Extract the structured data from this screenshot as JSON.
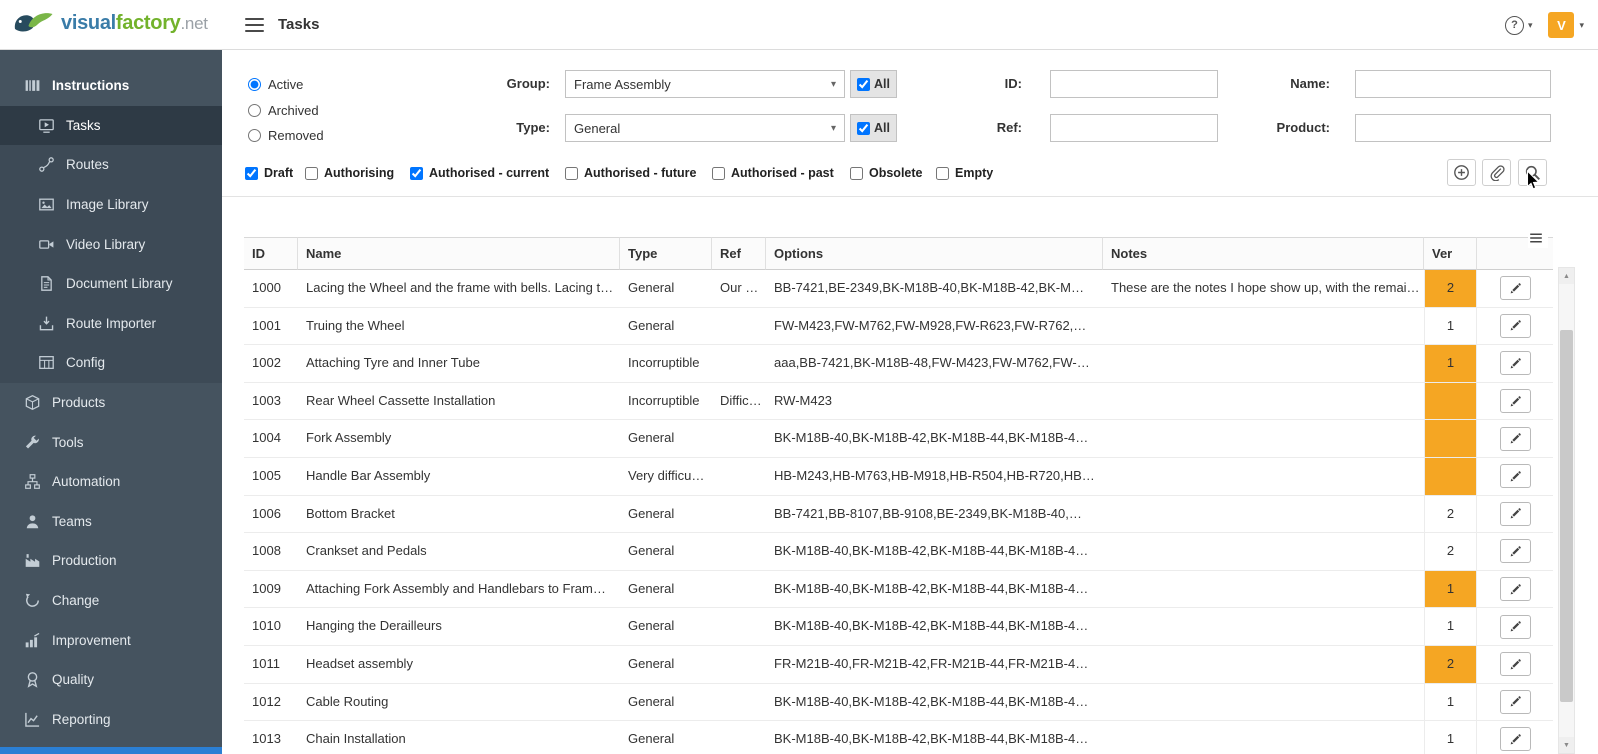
{
  "topbar": {
    "brand": {
      "part1": "visual",
      "part2": "factory",
      "part3": ".net"
    },
    "page_title": "Tasks",
    "help_glyph": "?",
    "chevron_glyph": "▾",
    "avatar_initial": "V"
  },
  "sidebar": {
    "items": [
      {
        "label": "Instructions",
        "icon": "instructions-icon",
        "level": 0,
        "header": true
      },
      {
        "label": "Tasks",
        "icon": "tasks-icon",
        "level": 1,
        "active": true
      },
      {
        "label": "Routes",
        "icon": "routes-icon",
        "level": 1
      },
      {
        "label": "Image Library",
        "icon": "image-library-icon",
        "level": 1
      },
      {
        "label": "Video Library",
        "icon": "video-library-icon",
        "level": 1
      },
      {
        "label": "Document Library",
        "icon": "document-library-icon",
        "level": 1
      },
      {
        "label": "Route Importer",
        "icon": "route-importer-icon",
        "level": 1
      },
      {
        "label": "Config",
        "icon": "config-icon",
        "level": 1
      },
      {
        "label": "Products",
        "icon": "products-icon",
        "level": 0
      },
      {
        "label": "Tools",
        "icon": "tools-icon",
        "level": 0
      },
      {
        "label": "Automation",
        "icon": "automation-icon",
        "level": 0
      },
      {
        "label": "Teams",
        "icon": "teams-icon",
        "level": 0
      },
      {
        "label": "Production",
        "icon": "production-icon",
        "level": 0
      },
      {
        "label": "Change",
        "icon": "change-icon",
        "level": 0
      },
      {
        "label": "Improvement",
        "icon": "improvement-icon",
        "level": 0
      },
      {
        "label": "Quality",
        "icon": "quality-icon",
        "level": 0
      },
      {
        "label": "Reporting",
        "icon": "reporting-icon",
        "level": 0
      }
    ]
  },
  "filters": {
    "status_options": [
      {
        "label": "Active",
        "checked": true
      },
      {
        "label": "Archived",
        "checked": false
      },
      {
        "label": "Removed",
        "checked": false
      }
    ],
    "group": {
      "label": "Group:",
      "value": "Frame Assembly"
    },
    "group_all": {
      "label": "All",
      "checked": true
    },
    "type": {
      "label": "Type:",
      "value": "General"
    },
    "type_all": {
      "label": "All",
      "checked": true
    },
    "id_filter": {
      "label": "ID:",
      "value": ""
    },
    "ref_filter": {
      "label": "Ref:",
      "value": ""
    },
    "name_filter": {
      "label": "Name:",
      "value": ""
    },
    "product_filter": {
      "label": "Product:",
      "value": ""
    },
    "state_options": [
      {
        "label": "Draft",
        "checked": true
      },
      {
        "label": "Authorising",
        "checked": false
      },
      {
        "label": "Authorised - current",
        "checked": true
      },
      {
        "label": "Authorised - future",
        "checked": false
      },
      {
        "label": "Authorised - past",
        "checked": false
      },
      {
        "label": "Obsolete",
        "checked": false
      },
      {
        "label": "Empty",
        "checked": false
      }
    ],
    "actions": [
      {
        "icon": "add-icon",
        "name": "add-task-button"
      },
      {
        "icon": "attach-icon",
        "name": "attach-button"
      },
      {
        "icon": "search-icon",
        "name": "search-button"
      }
    ]
  },
  "table": {
    "columns": [
      "ID",
      "Name",
      "Type",
      "Ref",
      "Options",
      "Notes",
      "Ver"
    ],
    "rows": [
      {
        "id": "1000",
        "name": "Lacing the Wheel and the frame with bells. Lacing t…",
        "type": "General",
        "ref": "Our …",
        "options": "BB-7421,BE-2349,BK-M18B-40,BK-M18B-42,BK-M…",
        "notes": "These are the notes I hope show up, with the remai…",
        "ver": "2",
        "ver_highlight": true
      },
      {
        "id": "1001",
        "name": "Truing the Wheel",
        "type": "General",
        "ref": "",
        "options": "FW-M423,FW-M762,FW-M928,FW-R623,FW-R762,…",
        "notes": "",
        "ver": "1",
        "ver_highlight": false
      },
      {
        "id": "1002",
        "name": "Attaching Tyre and Inner Tube",
        "type": "Incorruptible",
        "ref": "",
        "options": "aaa,BB-7421,BK-M18B-48,FW-M423,FW-M762,FW-…",
        "notes": "",
        "ver": "1",
        "ver_highlight": true
      },
      {
        "id": "1003",
        "name": "Rear Wheel Cassette Installation",
        "type": "Incorruptible",
        "ref": "Diffic…",
        "options": "RW-M423",
        "notes": "",
        "ver": "",
        "ver_highlight": true
      },
      {
        "id": "1004",
        "name": "Fork Assembly",
        "type": "General",
        "ref": "",
        "options": "BK-M18B-40,BK-M18B-42,BK-M18B-44,BK-M18B-4…",
        "notes": "",
        "ver": "",
        "ver_highlight": true
      },
      {
        "id": "1005",
        "name": "Handle Bar Assembly",
        "type": "Very difficu…",
        "ref": "",
        "options": "HB-M243,HB-M763,HB-M918,HB-R504,HB-R720,HB…",
        "notes": "",
        "ver": "",
        "ver_highlight": true
      },
      {
        "id": "1006",
        "name": "Bottom Bracket",
        "type": "General",
        "ref": "",
        "options": "BB-7421,BB-8107,BB-9108,BE-2349,BK-M18B-40,…",
        "notes": "",
        "ver": "2",
        "ver_highlight": false
      },
      {
        "id": "1008",
        "name": "Crankset and Pedals",
        "type": "General",
        "ref": "",
        "options": "BK-M18B-40,BK-M18B-42,BK-M18B-44,BK-M18B-4…",
        "notes": "",
        "ver": "2",
        "ver_highlight": false
      },
      {
        "id": "1009",
        "name": "Attaching Fork Assembly and Handlebars to Fram…",
        "type": "General",
        "ref": "",
        "options": "BK-M18B-40,BK-M18B-42,BK-M18B-44,BK-M18B-4…",
        "notes": "",
        "ver": "1",
        "ver_highlight": true
      },
      {
        "id": "1010",
        "name": "Hanging the Derailleurs",
        "type": "General",
        "ref": "",
        "options": "BK-M18B-40,BK-M18B-42,BK-M18B-44,BK-M18B-4…",
        "notes": "",
        "ver": "1",
        "ver_highlight": false
      },
      {
        "id": "1011",
        "name": "Headset assembly",
        "type": "General",
        "ref": "",
        "options": "FR-M21B-40,FR-M21B-42,FR-M21B-44,FR-M21B-4…",
        "notes": "",
        "ver": "2",
        "ver_highlight": true
      },
      {
        "id": "1012",
        "name": "Cable Routing",
        "type": "General",
        "ref": "",
        "options": "BK-M18B-40,BK-M18B-42,BK-M18B-44,BK-M18B-4…",
        "notes": "",
        "ver": "1",
        "ver_highlight": false
      },
      {
        "id": "1013",
        "name": "Chain Installation",
        "type": "General",
        "ref": "",
        "options": "BK-M18B-40,BK-M18B-42,BK-M18B-44,BK-M18B-4…",
        "notes": "",
        "ver": "1",
        "ver_highlight": false
      }
    ]
  },
  "scrollbar": {
    "up_glyph": "▲",
    "down_glyph": "▼"
  },
  "colors": {
    "accent_orange": "#F5A623",
    "sidebar_bg": "#45535F",
    "sidebar_sub_bg": "#3D4A56",
    "sidebar_active_bg": "#2E3A45",
    "brand_blue": "#3A7CA8",
    "brand_green": "#72B22B",
    "bottom_strip_blue": "#2B7FD4"
  }
}
